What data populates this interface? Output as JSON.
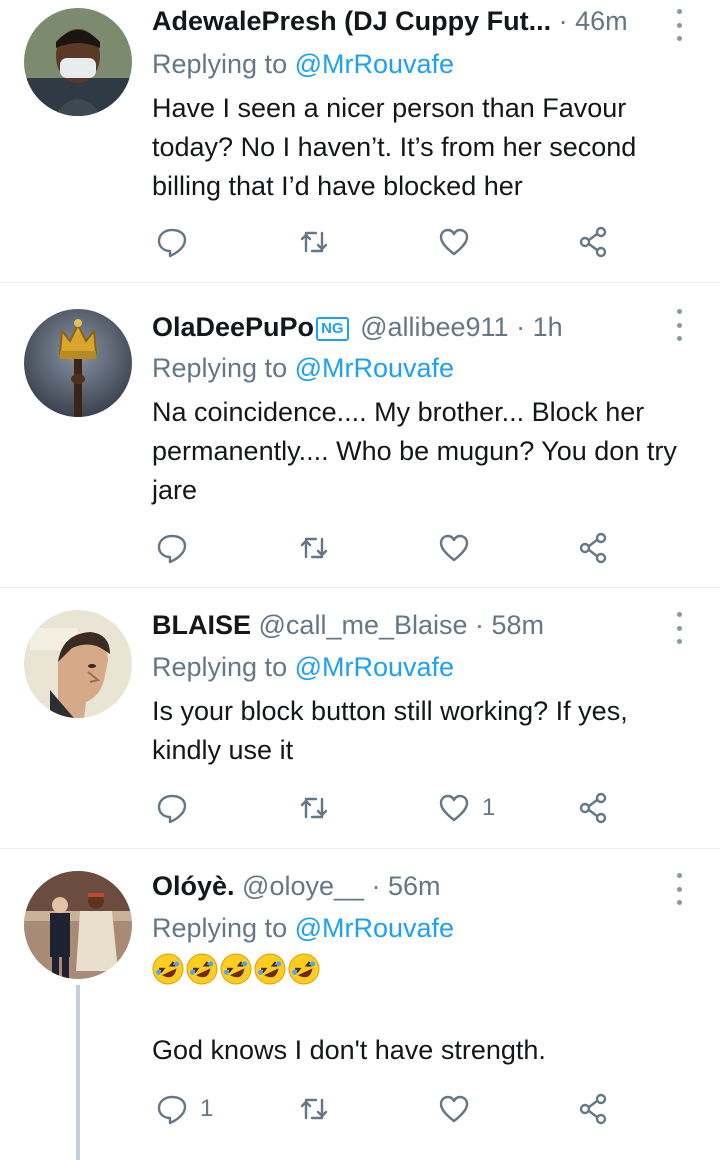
{
  "tweets": [
    {
      "display_name": "AdewalePresh (DJ Cuppy Fut...",
      "handle_time": " · 46m",
      "replying_prefix": "Replying to ",
      "replying_handle": "@MrRouvafe",
      "text": "Have I seen a nicer person than Favour today? No I haven’t. It’s from her second billing that I’d have blocked her",
      "reply_count": "",
      "like_count": ""
    },
    {
      "display_name": "OlaDeePuPo",
      "badge": "NG",
      "handle_time": " @allibee911 · 1h",
      "replying_prefix": "Replying to ",
      "replying_handle": "@MrRouvafe",
      "text": "Na coincidence.... My brother... Block her permanently.... Who be mugun? You don try jare",
      "reply_count": "",
      "like_count": ""
    },
    {
      "display_name": "BLAISE",
      "handle_time": " @call_me_Blaise · 58m",
      "replying_prefix": "Replying to ",
      "replying_handle": "@MrRouvafe",
      "text": "Is your block button still working? If yes, kindly use it",
      "reply_count": "",
      "like_count": "1"
    },
    {
      "display_name": "Olóyè.",
      "handle_time": " @oloye__ · 56m",
      "replying_prefix": "Replying to ",
      "replying_handle": "@MrRouvafe",
      "emoji_line": "🤣🤣🤣🤣🤣",
      "text": "God knows I don't have strength.",
      "reply_count": "1",
      "like_count": ""
    }
  ],
  "icons": {
    "reply": "reply-icon",
    "retweet": "retweet-icon",
    "like": "like-icon",
    "share": "share-icon",
    "more": "more-options-icon"
  },
  "colors": {
    "accent": "#1da1f2",
    "meta": "#657786",
    "divider": "#e6ecf0"
  }
}
